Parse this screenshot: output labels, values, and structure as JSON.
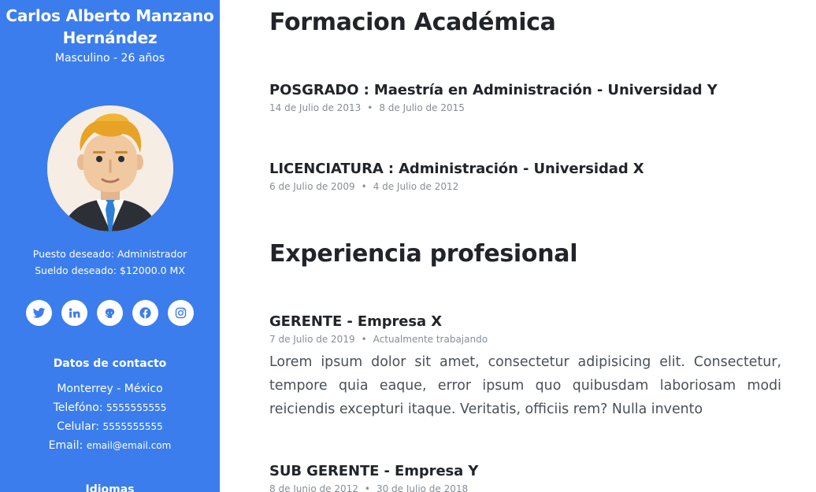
{
  "profile": {
    "name": "Carlos Alberto Manzano Hernández",
    "gender_age": "Masculino - 26 años",
    "puesto_label": "Puesto deseado:",
    "puesto_value": "Administrador",
    "sueldo_label": "Sueldo deseado:",
    "sueldo_value": "$12000.0 MX"
  },
  "socials": [
    {
      "icon": "twitter-icon"
    },
    {
      "icon": "linkedin-icon"
    },
    {
      "icon": "github-icon"
    },
    {
      "icon": "facebook-icon"
    },
    {
      "icon": "instagram-icon"
    }
  ],
  "contact": {
    "title": "Datos de contacto",
    "location": "Monterrey - México",
    "phone_label": "Telefóno:",
    "phone_value": "5555555555",
    "cell_label": "Celular:",
    "cell_value": "5555555555",
    "email_label": "Email:",
    "email_value": "email@email.com"
  },
  "languages": {
    "title": "Idiomas"
  },
  "education": {
    "title": "Formacion Académica",
    "items": [
      {
        "title": "POSGRADO : Maestría en Administración - Universidad Y",
        "start": "14 de Julio de 2013",
        "end": "8 de Julio de 2015"
      },
      {
        "title": "LICENCIATURA : Administración - Universidad X",
        "start": "6 de Julio de 2009",
        "end": "4 de Julio de 2012"
      }
    ]
  },
  "experience": {
    "title": "Experiencia profesional",
    "items": [
      {
        "title": "GERENTE - Empresa X",
        "start": "7 de Julio de 2019",
        "end": "Actualmente trabajando",
        "description": "Lorem ipsum dolor sit amet, consectetur adipisicing elit. Consectetur, tempore quia eaque, error ipsum quo quibusdam laboriosam modi reiciendis excepturi itaque. Veritatis, officiis rem? Nulla invento"
      },
      {
        "title": "SUB GERENTE - Empresa Y",
        "start": "8 de Junio de 2012",
        "end": "30 de Julio de 2018"
      }
    ]
  },
  "colors": {
    "sidebar": "#3b7ded",
    "social_icon": "#3b7ded"
  }
}
